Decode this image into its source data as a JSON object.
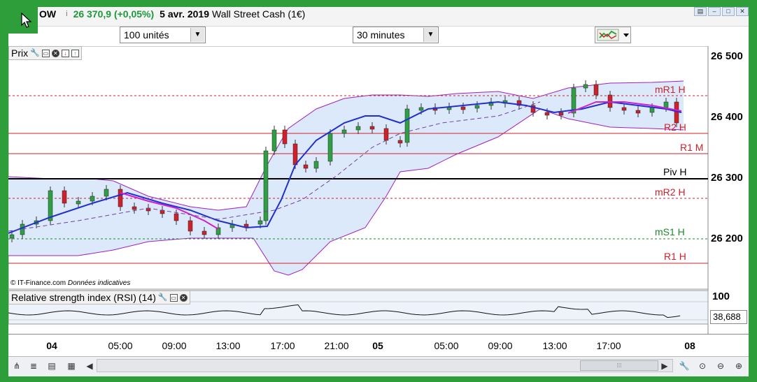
{
  "title_bar": {
    "instrument": "OW",
    "info_icon": "i",
    "price_change": "26 370,9 (+0,05%)",
    "date": "5 avr. 2019",
    "name": "Wall Street Cash (1€)"
  },
  "toolbar": {
    "quantity_select": "100 unités",
    "timeframe_select": "30 minutes",
    "chart_type_icon": "chart-type-icon"
  },
  "price_panel": {
    "label": "Prix",
    "y_ticks": [
      "26 500",
      "26 400",
      "26 300",
      "26 200"
    ],
    "levels": [
      {
        "name": "mR1 H",
        "color": "#d0202a"
      },
      {
        "name": "R2 H",
        "color": "#d0202a"
      },
      {
        "name": "R1 M",
        "color": "#d0202a"
      },
      {
        "name": "Piv H",
        "color": "#000000"
      },
      {
        "name": "mR2 H",
        "color": "#d0202a"
      },
      {
        "name": "mS1 H",
        "color": "#1a8a2a"
      },
      {
        "name": "R1 H",
        "color": "#d0202a"
      }
    ],
    "copyright": "© IT-Finance.com",
    "disclaimer": "Données indicatives"
  },
  "rsi_panel": {
    "label": "Relative strength index (RSI)",
    "period": "(14)",
    "y_tick": "100",
    "current_value": "38,688"
  },
  "time_axis": {
    "ticks": [
      {
        "label": "04",
        "bold": true
      },
      {
        "label": "05:00",
        "bold": false
      },
      {
        "label": "09:00",
        "bold": false
      },
      {
        "label": "13:00",
        "bold": false
      },
      {
        "label": "17:00",
        "bold": false
      },
      {
        "label": "21:00",
        "bold": false
      },
      {
        "label": "05",
        "bold": true
      },
      {
        "label": "05:00",
        "bold": false
      },
      {
        "label": "09:00",
        "bold": false
      },
      {
        "label": "13:00",
        "bold": false
      },
      {
        "label": "17:00",
        "bold": false
      },
      {
        "label": "08",
        "bold": true
      }
    ]
  },
  "colors": {
    "frame": "#2e9e3a",
    "bullish": "#2ea043",
    "bearish": "#d0202a",
    "ma": "#2030d0",
    "bands": "#a020c0",
    "band_fill": "#dce9fb"
  }
}
